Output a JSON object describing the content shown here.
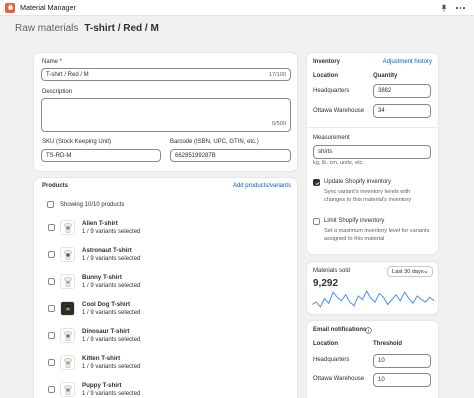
{
  "app": {
    "title": "Material Manager"
  },
  "breadcrumb": {
    "parent": "Raw materials",
    "current": "T-shirt / Red / M"
  },
  "details": {
    "name_label": "Name *",
    "name_value": "T-shirt / Red / M",
    "name_count": "17/100",
    "description_label": "Description",
    "description_value": "",
    "description_count": "0/500",
    "sku_label": "SKU (Stock Keeping Unit)",
    "sku_value": "TS-RD-M",
    "barcode_label": "Barcode (ISBN, UPC, GTIN, etc.)",
    "barcode_value": "66285199287B"
  },
  "products": {
    "title": "Products",
    "add_link": "Add products/variants",
    "showing": "Showing 10/10 products",
    "items": [
      {
        "name": "Alien T-shirt",
        "sub": "1 / 9 variants selected"
      },
      {
        "name": "Astronaut T-shirt",
        "sub": "1 / 9 variants selected"
      },
      {
        "name": "Bunny T-shirt",
        "sub": "1 / 9 variants selected"
      },
      {
        "name": "Cool Dog T-shirt",
        "sub": "1 / 9 variants selected"
      },
      {
        "name": "Dinosaur T-shirt",
        "sub": "1 / 9 variants selected"
      },
      {
        "name": "Kitten T-shirt",
        "sub": "1 / 9 variants selected"
      },
      {
        "name": "Puppy T-shirt",
        "sub": "1 / 9 variants selected"
      }
    ]
  },
  "inventory": {
    "title": "Inventory",
    "history_link": "Adjustment history",
    "col_location": "Location",
    "col_quantity": "Quantity",
    "rows": [
      {
        "location": "Headquarters",
        "quantity": "3882"
      },
      {
        "location": "Ottawa Warehouse",
        "quantity": "34"
      }
    ],
    "measurement_label": "Measurement",
    "measurement_value": "shirts",
    "measurement_hint": "kg, lb, cm, units, etc.",
    "update_label": "Update Shopify inventory",
    "update_hint": "Sync variant's inventory levels with changes to this material's inventory",
    "update_checked": true,
    "limit_label": "Limit Shopify inventory",
    "limit_hint": "Set a maximum inventory level for variants assigned to this material",
    "limit_checked": false
  },
  "sales": {
    "title": "Materials sold",
    "value": "9,292",
    "range": "Last 30 days",
    "line_color": "#4b8ef0",
    "chart_data": {
      "type": "line",
      "values": [
        20,
        22,
        18,
        25,
        21,
        30,
        26,
        23,
        28,
        22,
        19,
        27,
        24,
        31,
        25,
        22,
        29,
        26,
        20,
        24,
        28,
        23,
        30,
        25,
        21,
        27,
        24,
        22,
        26,
        23
      ]
    }
  },
  "notifications": {
    "title": "Email notifications",
    "col_location": "Location",
    "col_threshold": "Threshold",
    "rows": [
      {
        "location": "Headquarters",
        "threshold": "10"
      },
      {
        "location": "Ottawa Warehouse",
        "threshold": "10"
      }
    ]
  },
  "icons": {
    "app": "app-logo-icon",
    "pin": "pin-icon",
    "more": "more-icon",
    "info": "info-icon",
    "chevron": "chevron-down-icon"
  },
  "colors": {
    "accent": "#005bd3",
    "app_icon": "#e8633b",
    "background": "#f1f1f1"
  }
}
